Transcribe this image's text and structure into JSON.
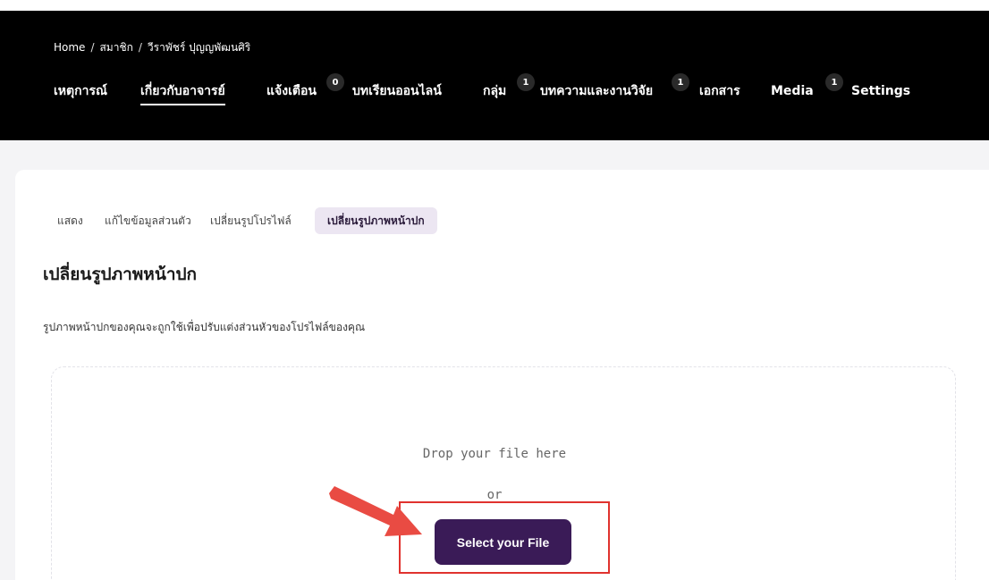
{
  "breadcrumb": {
    "items": [
      "Home",
      "สมาชิก",
      "วีราพัชร์ ปุญญพัฒนศิริ"
    ],
    "separator": "/"
  },
  "nav": {
    "items": [
      {
        "label": "เหตุการณ์",
        "badge": null
      },
      {
        "label": "เกี่ยวกับอาจารย์",
        "badge": null,
        "active": true
      },
      {
        "label": "แจ้งเตือน",
        "badge": "0"
      },
      {
        "label": "บทเรียนออนไลน์",
        "badge": null
      },
      {
        "label": "กลุ่ม",
        "badge": "1"
      },
      {
        "label": "บทความและงานวิจัย",
        "badge": "1"
      },
      {
        "label": "เอกสาร",
        "badge": null
      },
      {
        "label": "Media",
        "badge": "1"
      },
      {
        "label": "Settings",
        "badge": null
      }
    ]
  },
  "subtabs": {
    "items": [
      "แสดง",
      "แก้ไขข้อมูลส่วนตัว",
      "เปลี่ยนรูปโปรไฟล์",
      "เปลี่ยนรูปภาพหน้าปก"
    ],
    "active_index": 3
  },
  "section": {
    "title": "เปลี่ยนรูปภาพหน้าปก",
    "description": "รูปภาพหน้าปกของคุณจะถูกใช้เพื่อปรับแต่งส่วนหัวของโปรไฟล์ของคุณ"
  },
  "dropzone": {
    "drop_text": "Drop your file here",
    "or_text": "or",
    "button_label": "Select your File"
  },
  "colors": {
    "topbar": "#000000",
    "button": "#3a1b57",
    "active_subtab_bg": "#ece6f2",
    "highlight": "#e0322e",
    "arrow": "#e94b43"
  },
  "icons": {
    "annotation": "red-arrow-icon"
  }
}
